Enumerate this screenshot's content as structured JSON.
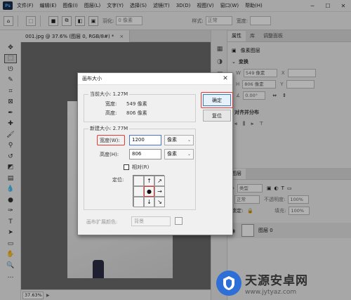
{
  "app": {
    "logo": "Ps",
    "menu": [
      "文件(F)",
      "编辑(E)",
      "图像(I)",
      "图层(L)",
      "文字(Y)",
      "选择(S)",
      "滤镜(T)",
      "3D(D)",
      "视图(V)",
      "窗口(W)",
      "帮助(H)"
    ]
  },
  "options": {
    "feather_label": "羽化:",
    "feather_value": "0 像素",
    "style_label": "样式:",
    "style_value": "正常",
    "width_label": "宽度:"
  },
  "document": {
    "tab_label": "001.jpg @ 37.6% (图层 0, RGB/8#) *",
    "zoom": "37.63%"
  },
  "right_panel": {
    "tabs": [
      "属性",
      "库",
      "调整面板"
    ],
    "pixel_layer_label": "像素图层",
    "transform_title": "变换",
    "w_label": "W",
    "w_value": "549 像素",
    "h_label": "H",
    "h_value": "806 像素",
    "angle_value": "0.00°",
    "align_title": "对齐并分布",
    "layers_tab": "图层",
    "layers_kind": "类型",
    "opacity_label": "不透明度:",
    "opacity_value": "100%",
    "fill_label": "填充:",
    "fill_value": "100%",
    "normal_label": "正常",
    "lock_label": "锁定:",
    "layer_name": "图层 0"
  },
  "dialog": {
    "title": "画布大小",
    "current_size_label": "当前大小: 1.27M",
    "current_width_label": "宽度:",
    "current_width_value": "549 像素",
    "current_height_label": "高度:",
    "current_height_value": "806 像素",
    "new_size_label": "新建大小: 2.77M",
    "width_label": "宽度(W):",
    "width_value": "1200",
    "width_unit": "像素",
    "height_label": "高度(H):",
    "height_value": "806",
    "height_unit": "像素",
    "relative_label": "相对(R)",
    "anchor_label": "定位:",
    "ok_label": "确定",
    "reset_label": "复位",
    "extension_label": "画布扩展颜色:",
    "extension_value": "背景"
  },
  "watermark": {
    "title": "天源安卓网",
    "url": "www.jytyaz.com"
  },
  "colors": {
    "accent": "#3c7fb1",
    "highlight": "#e53935",
    "watermark_blue": "#2d6fd6"
  }
}
